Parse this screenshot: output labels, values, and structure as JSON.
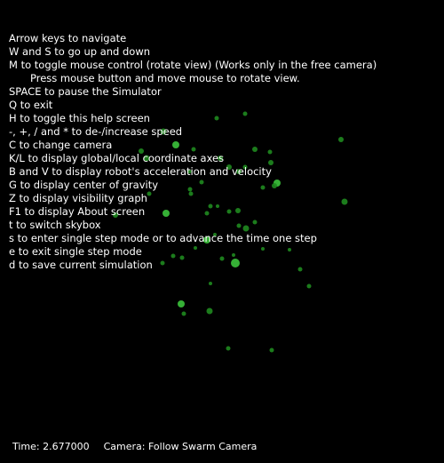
{
  "help": {
    "lines": [
      "Arrow keys to navigate",
      "W and S to go up and down",
      "M to toggle mouse control (rotate view) (Works only in the free camera)",
      "Press mouse button and move mouse to rotate view.",
      "SPACE to pause the Simulator",
      "Q to exit",
      "H to toggle this help screen",
      "-, +, / and * to de-/increase speed",
      "C to change camera",
      "K/L to display global/local coordinate axes",
      "B and V to display robot's acceleration and velocity",
      "G to display center of gravity",
      "Z to display visibility graph",
      "F1 to display About screen",
      "t to switch skybox",
      "s to enter single step mode or to advance the time one step",
      "e to exit single step mode",
      "d to save current simulation"
    ]
  },
  "status": {
    "time": "Time: 2.677000",
    "camera": "Camera: Follow Swarm Camera"
  },
  "colors": {
    "background": "#000000",
    "text": "#ffffff",
    "robot": "#1f8a1f",
    "robot_highlight": "#3fcf3f"
  },
  "scene": {
    "description_icon": "swarm-robot-icon"
  }
}
